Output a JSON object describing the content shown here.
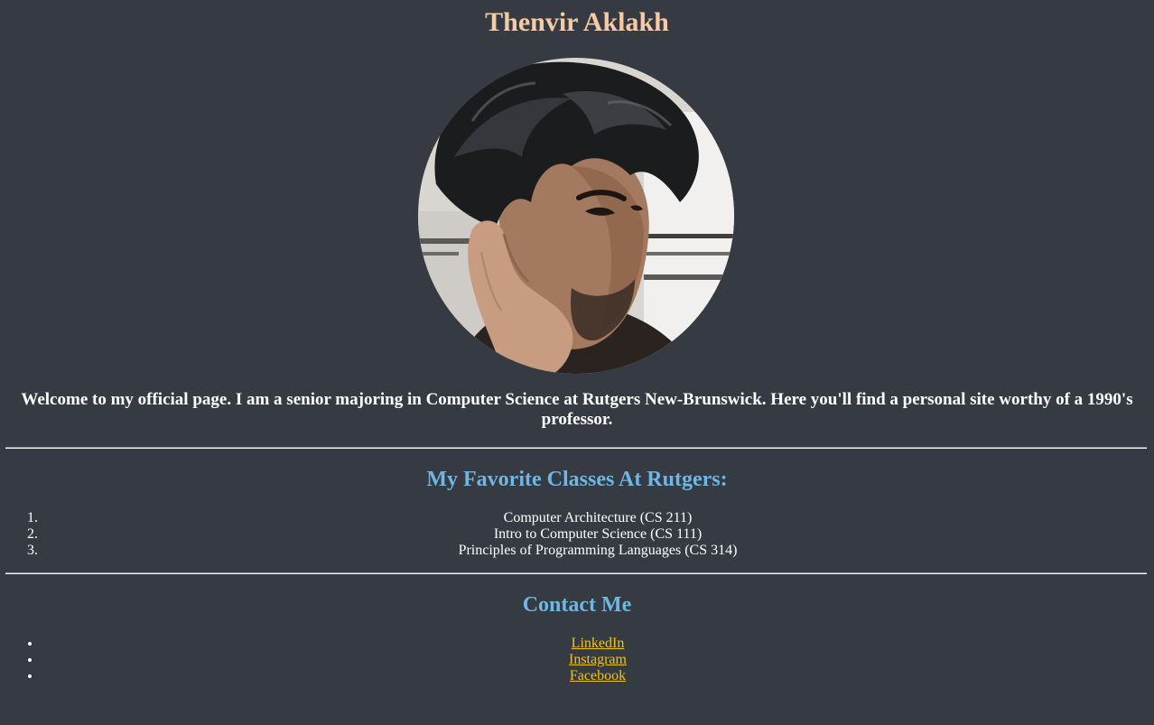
{
  "header": {
    "title": "Thenvir Aklakh"
  },
  "intro": {
    "text": "Welcome to my official page. I am a senior majoring in Computer Science at Rutgers New-Brunswick. Here you'll find a personal site worthy of a 1990's professor."
  },
  "classes": {
    "heading": "My Favorite Classes At Rutgers:",
    "items": [
      "Computer Architecture (CS 211)",
      "Intro to Computer Science (CS 111)",
      "Principles of Programming Languages (CS 314)"
    ]
  },
  "contact": {
    "heading": "Contact Me",
    "links": [
      "LinkedIn",
      "Instagram",
      "Facebook"
    ]
  },
  "colors": {
    "background": "#363a43",
    "title": "#f7cba2",
    "section_heading": "#6cb7e3",
    "link": "#f2c21f",
    "text": "#ffffff"
  }
}
